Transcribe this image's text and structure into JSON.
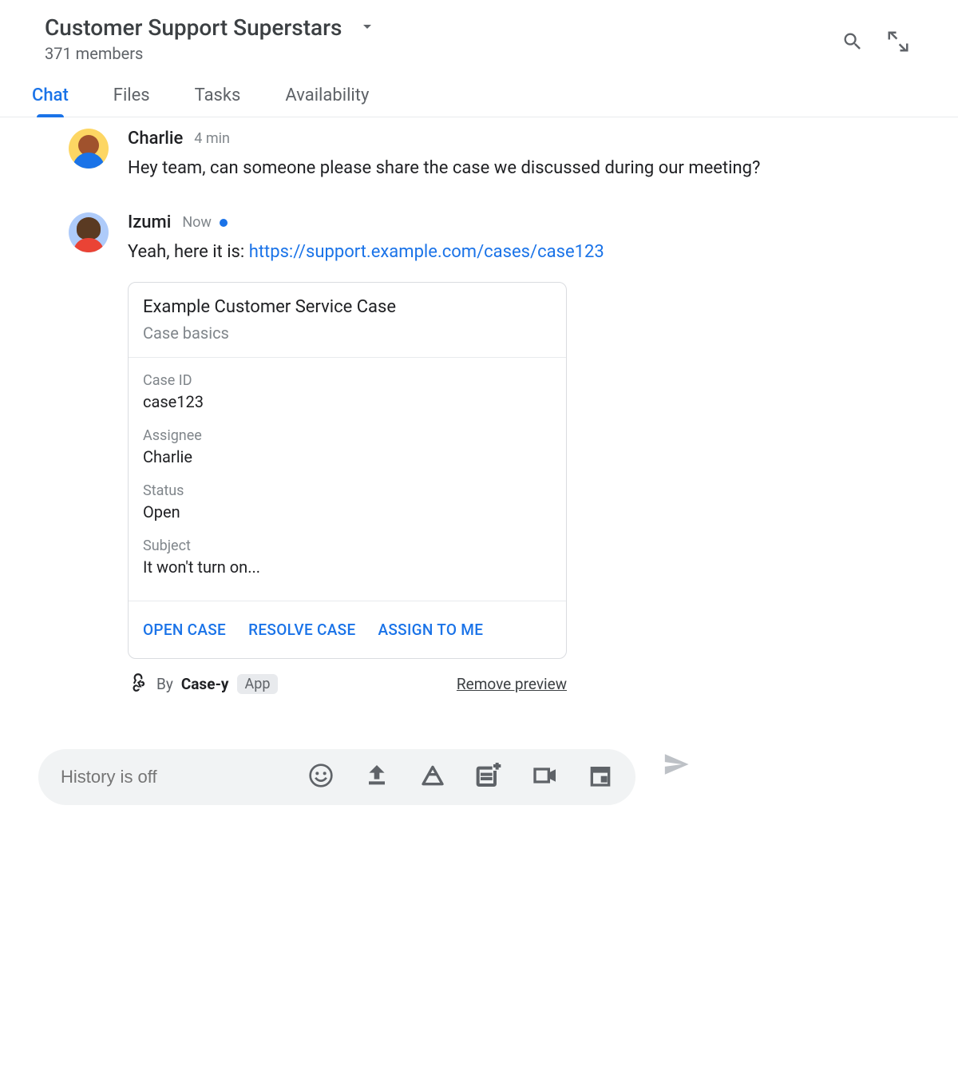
{
  "header": {
    "title": "Customer Support Superstars",
    "members": "371 members"
  },
  "tabs": [
    "Chat",
    "Files",
    "Tasks",
    "Availability"
  ],
  "messages": [
    {
      "sender": "Charlie",
      "time": "4 min",
      "text": "Hey team, can someone please share the case we discussed during our meeting?"
    },
    {
      "sender": "Izumi",
      "time": "Now",
      "text_prefix": "Yeah, here it is: ",
      "link": "https://support.example.com/cases/case123"
    }
  ],
  "card": {
    "title": "Example Customer Service Case",
    "subtitle": "Case basics",
    "fields": [
      {
        "label": "Case ID",
        "value": "case123"
      },
      {
        "label": "Assignee",
        "value": "Charlie"
      },
      {
        "label": "Status",
        "value": "Open"
      },
      {
        "label": "Subject",
        "value": "It won't turn on..."
      }
    ],
    "actions": [
      "OPEN CASE",
      "RESOLVE CASE",
      "ASSIGN TO ME"
    ],
    "by_prefix": "By ",
    "app_name": "Case-y",
    "app_badge": "App",
    "remove": "Remove preview"
  },
  "composer": {
    "placeholder": "History is off"
  }
}
